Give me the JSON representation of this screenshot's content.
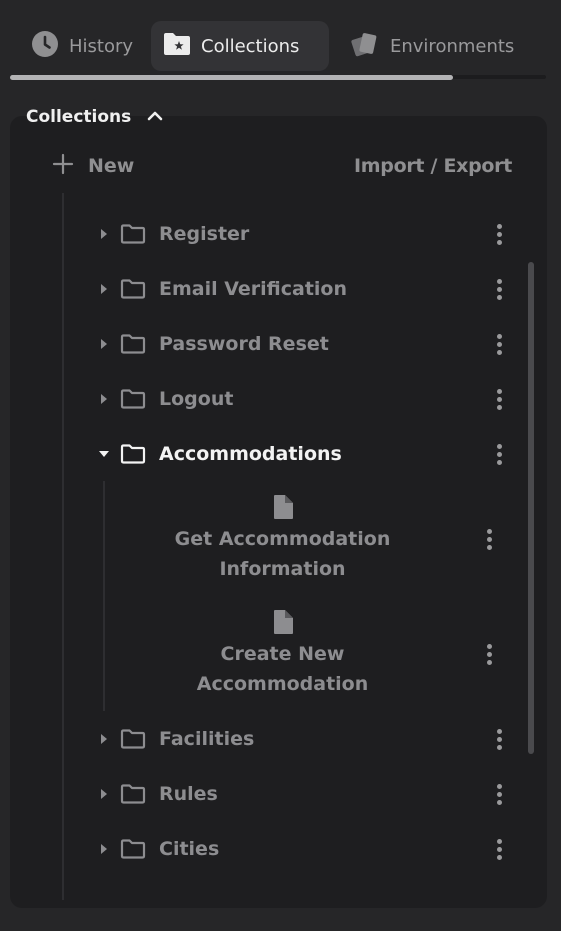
{
  "tabs": [
    {
      "label": "History",
      "icon": "clock-icon",
      "active": false
    },
    {
      "label": "Collections",
      "icon": "folder-star-icon",
      "active": true
    },
    {
      "label": "Environments",
      "icon": "layers-icon",
      "active": false
    }
  ],
  "panel": {
    "title": "Collections",
    "new_label": "New",
    "import_export_label": "Import / Export"
  },
  "tree": {
    "folders_before": [
      {
        "label": "Register"
      },
      {
        "label": "Email Verification"
      },
      {
        "label": "Password Reset"
      },
      {
        "label": "Logout"
      }
    ],
    "open_folder": {
      "label": "Accommodations",
      "requests": [
        {
          "line1": "Get Accommodation",
          "line2": "Information"
        },
        {
          "line1": "Create New",
          "line2": "Accommodation"
        }
      ]
    },
    "folders_after": [
      {
        "label": "Facilities"
      },
      {
        "label": "Rules"
      },
      {
        "label": "Cities"
      }
    ]
  },
  "colors": {
    "background": "#262628",
    "panel": "#1e1e20",
    "active_tab": "#333336",
    "muted_text": "#8d8d90",
    "bright_text": "#f3f3f3"
  }
}
